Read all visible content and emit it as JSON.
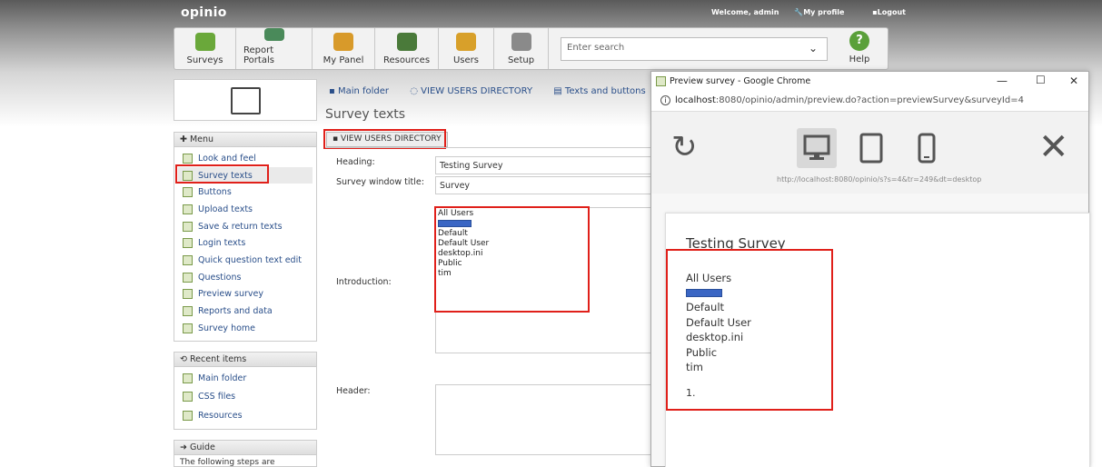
{
  "app": {
    "logo": "opinio"
  },
  "userbar": {
    "welcome": "Welcome, admin",
    "profile": "My profile",
    "logout": "Logout"
  },
  "toolbar": {
    "items": [
      {
        "label": "Surveys",
        "icon": "surveys-icon",
        "color": "#6aa83a"
      },
      {
        "label": "Report Portals",
        "icon": "report-portals-icon",
        "color": "#4a8a5a"
      },
      {
        "label": "My Panel",
        "icon": "my-panel-icon",
        "color": "#d89a2a"
      },
      {
        "label": "Resources",
        "icon": "resources-icon",
        "color": "#4a7a3a"
      },
      {
        "label": "Users",
        "icon": "users-icon",
        "color": "#d8a02a"
      },
      {
        "label": "Setup",
        "icon": "setup-icon",
        "color": "#8a8a8a"
      }
    ],
    "search_placeholder": "Enter search",
    "help": "Help"
  },
  "sidebar": {
    "menu_title": "Menu",
    "menu_items": [
      "Look and feel",
      "Survey texts",
      "Buttons",
      "Upload texts",
      "Save & return texts",
      "Login texts",
      "Quick question text edit",
      "Questions",
      "Preview survey",
      "Reports and data",
      "Survey home"
    ],
    "recent_title": "Recent items",
    "recent_items": [
      "Main folder",
      "CSS files",
      "Resources"
    ],
    "guide_title": "Guide",
    "guide_text": "The following steps are"
  },
  "breadcrumb": {
    "main": "Main folder",
    "directory": "VIEW USERS DIRECTORY",
    "current": "Texts and buttons"
  },
  "page": {
    "title": "Survey texts",
    "tab": "VIEW USERS DIRECTORY",
    "labels": {
      "heading": "Heading:",
      "window_title": "Survey window title:",
      "introduction": "Introduction:",
      "header": "Header:"
    },
    "values": {
      "heading": "Testing Survey",
      "window_title": "Survey"
    },
    "intro_list": [
      "All Users",
      "Default",
      "Default User",
      "desktop.ini",
      "Public",
      "tim"
    ]
  },
  "chrome": {
    "title": "Preview survey - Google Chrome",
    "url_host": "localhost",
    "url_path": ":8080/opinio/admin/preview.do?action=previewSurvey&surveyId=4",
    "preview_url": "http://localhost:8080/opinio/s?s=4&tr=249&dt=desktop",
    "preview": {
      "heading": "Testing Survey",
      "list": [
        "All Users",
        "Default",
        "Default User",
        "desktop.ini",
        "Public",
        "tim"
      ],
      "number": "1."
    }
  },
  "colors": {
    "highlight": "#e0201a",
    "link": "#2a4f8a",
    "bar_blue": "#3a66c4"
  }
}
